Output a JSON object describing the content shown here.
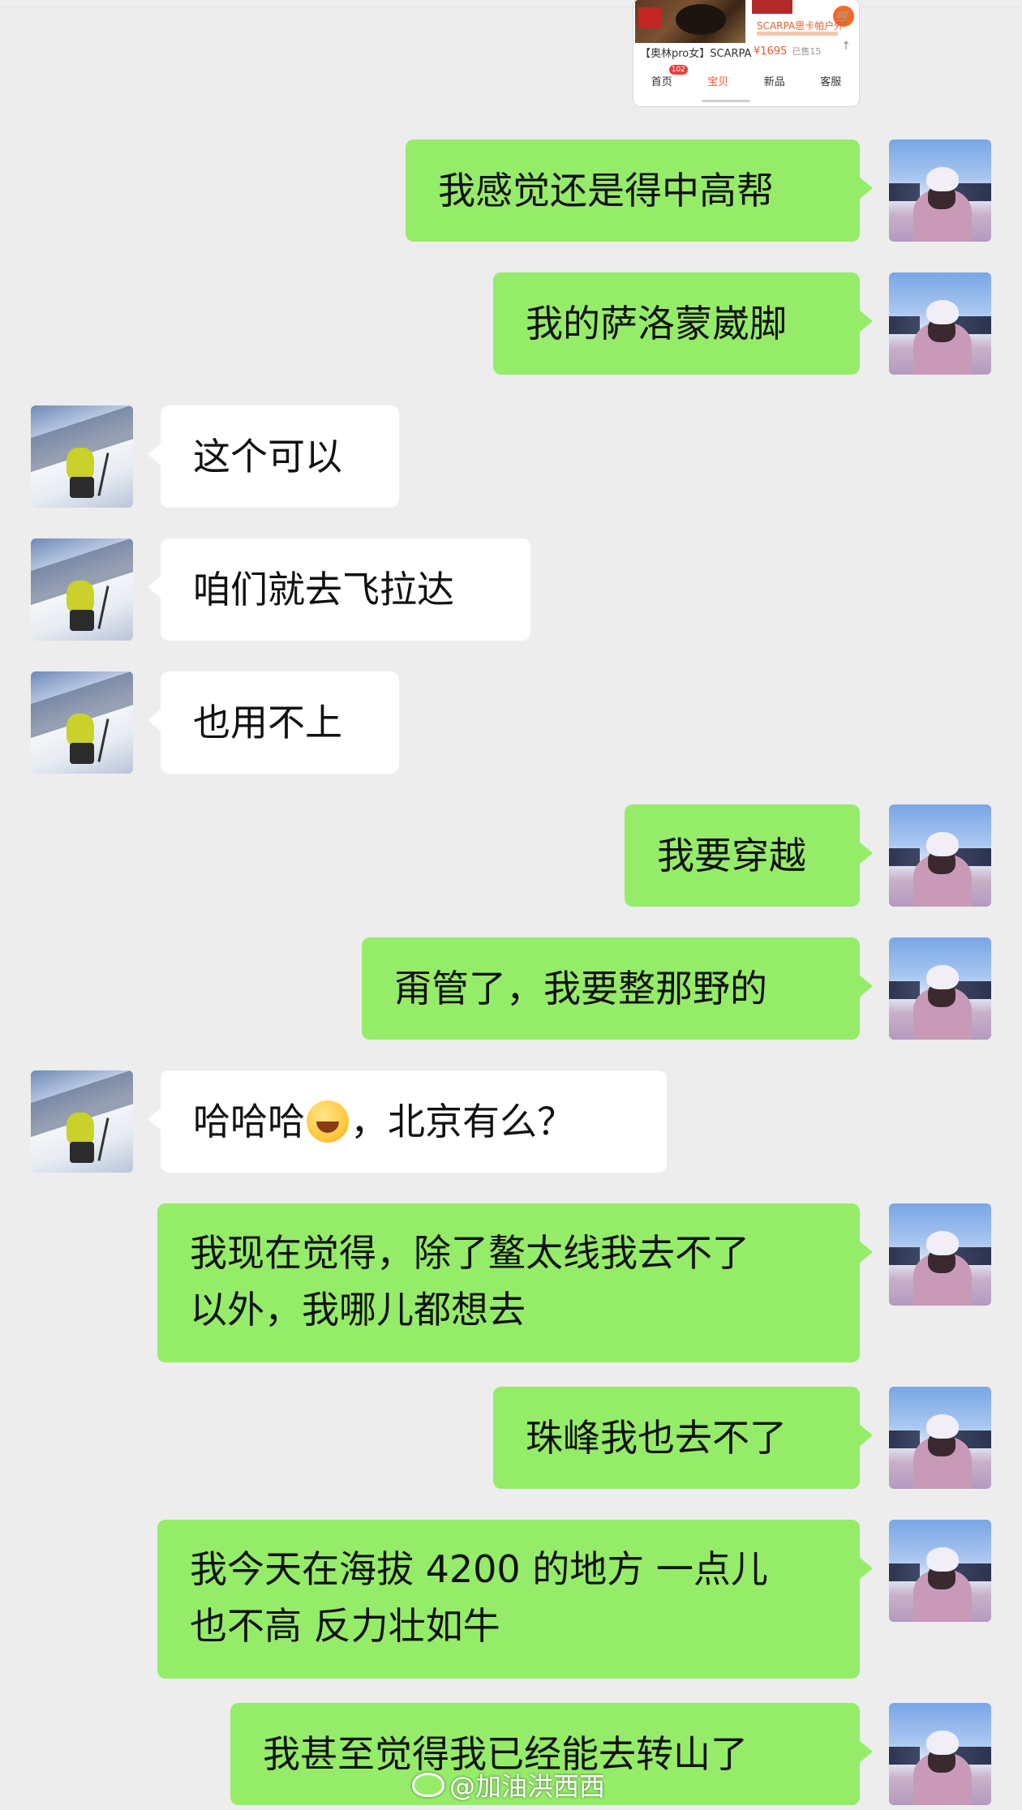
{
  "shared_card": {
    "store_name": "SCARPA思卡帕户外",
    "product_title": "【奥林pro女】SCARPA",
    "price": "¥1695",
    "sold": "已售15",
    "nav": [
      "首页",
      "宝贝",
      "新品",
      "客服"
    ],
    "nav_badge": "102",
    "active_nav": "宝贝"
  },
  "messages": [
    {
      "side": "right",
      "sender": "me",
      "text": "我感觉还是得中高帮"
    },
    {
      "side": "right",
      "sender": "me",
      "text": "我的萨洛蒙崴脚"
    },
    {
      "side": "left",
      "sender": "friend",
      "text": "这个可以"
    },
    {
      "side": "left",
      "sender": "friend",
      "text": "咱们就去飞拉达"
    },
    {
      "side": "left",
      "sender": "friend",
      "text": "也用不上"
    },
    {
      "side": "right",
      "sender": "me",
      "text": "我要穿越"
    },
    {
      "side": "right",
      "sender": "me",
      "text": "甭管了，我要整那野的"
    },
    {
      "side": "left",
      "sender": "friend",
      "text_before_emoji": "哈哈哈",
      "emoji": "rolling-on-floor-laughing",
      "text_after_emoji": "，北京有么？"
    },
    {
      "side": "right",
      "sender": "me",
      "lines": [
        "我现在觉得，除了鳌太线我去不了",
        "以外，我哪儿都想去"
      ]
    },
    {
      "side": "right",
      "sender": "me",
      "text": "珠峰我也去不了"
    },
    {
      "side": "right",
      "sender": "me",
      "lines": [
        "我今天在海拔 4200 的地方 一点儿",
        "也不高 反力壮如牛"
      ]
    },
    {
      "side": "right",
      "sender": "me",
      "text": "我甚至觉得我已经能去转山了"
    }
  ],
  "watermark": "@加油洪西西",
  "colors": {
    "background": "#ededed",
    "my_bubble": "#95ec69",
    "friend_bubble": "#ffffff",
    "text": "#111111"
  }
}
